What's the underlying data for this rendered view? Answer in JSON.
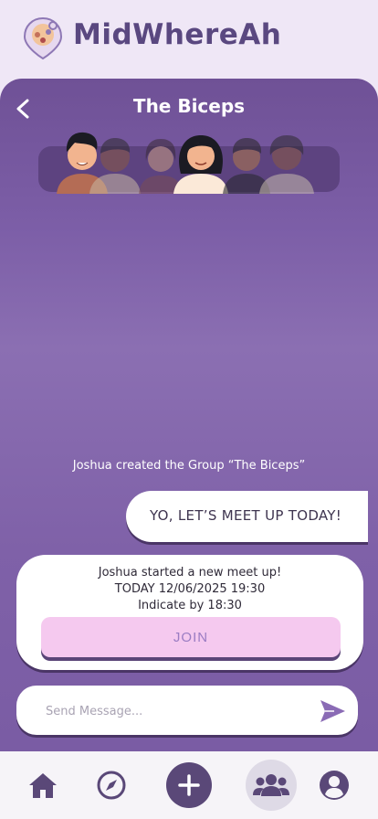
{
  "app": {
    "name": "MidWhereAh"
  },
  "chat": {
    "title": "The Biceps",
    "system_message": "Joshua created the Group “The Biceps”",
    "outgoing_message": "YO, LET’S MEET UP TODAY!",
    "meetup": {
      "line1": "Joshua started a new meet up!",
      "line2": "TODAY 12/06/2025 19:30",
      "line3": "Indicate by 18:30",
      "join_label": "JOIN"
    }
  },
  "composer": {
    "placeholder": "Send Message..."
  },
  "nav": {
    "items": [
      {
        "icon": "home-icon"
      },
      {
        "icon": "compass-icon"
      },
      {
        "icon": "plus-icon"
      },
      {
        "icon": "group-icon",
        "active": true
      },
      {
        "icon": "profile-icon"
      }
    ]
  },
  "colors": {
    "brand": "#5a4880",
    "panel": "#7c5ea7",
    "join_button": "#f5c9ef",
    "nav_background": "#f6f4f8"
  }
}
